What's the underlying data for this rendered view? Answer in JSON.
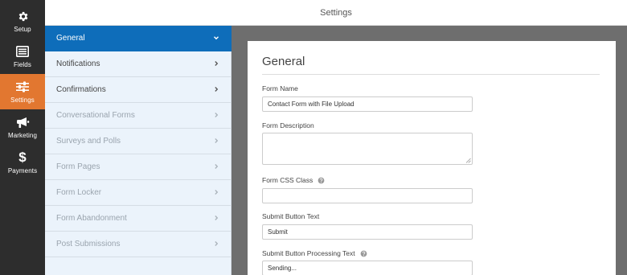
{
  "header": {
    "title": "Settings"
  },
  "iconbar": {
    "items": [
      {
        "label": "Setup",
        "icon": "gear-icon"
      },
      {
        "label": "Fields",
        "icon": "fields-icon"
      },
      {
        "label": "Settings",
        "icon": "sliders-icon",
        "active": true
      },
      {
        "label": "Marketing",
        "icon": "megaphone-icon"
      },
      {
        "label": "Payments",
        "icon": "dollar-icon",
        "glyph": "$"
      }
    ]
  },
  "nav": {
    "items": [
      {
        "label": "General",
        "active": true
      },
      {
        "label": "Notifications"
      },
      {
        "label": "Confirmations"
      },
      {
        "label": "Conversational Forms",
        "disabled": true
      },
      {
        "label": "Surveys and Polls",
        "disabled": true
      },
      {
        "label": "Form Pages",
        "disabled": true
      },
      {
        "label": "Form Locker",
        "disabled": true
      },
      {
        "label": "Form Abandonment",
        "disabled": true
      },
      {
        "label": "Post Submissions",
        "disabled": true
      }
    ]
  },
  "panel": {
    "title": "General",
    "form_name": {
      "label": "Form Name",
      "value": "Contact Form with File Upload"
    },
    "form_description": {
      "label": "Form Description",
      "value": ""
    },
    "form_css_class": {
      "label": "Form CSS Class",
      "value": ""
    },
    "submit_text": {
      "label": "Submit Button Text",
      "value": "Submit"
    },
    "submit_processing_text": {
      "label": "Submit Button Processing Text",
      "value": "Sending..."
    }
  },
  "colors": {
    "accent_orange": "#e27730",
    "active_blue": "#0e6dba",
    "sidebar_dark": "#2d2d2d",
    "nav_bg": "#ebf3fb"
  }
}
